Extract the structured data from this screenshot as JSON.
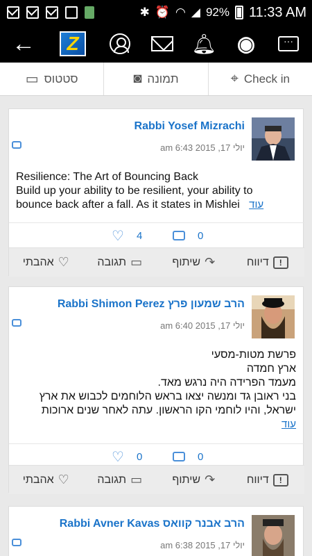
{
  "status_bar": {
    "battery": "92%",
    "time": "11:33 AM"
  },
  "app_bar": {
    "logo_letter": "Z"
  },
  "composer": {
    "tabs": [
      {
        "label": "סטטוס",
        "icon": "speech-bubble-icon"
      },
      {
        "label": "תמונה",
        "icon": "camera-icon"
      },
      {
        "label": "Check in",
        "icon": "location-pin-icon"
      }
    ]
  },
  "posts": [
    {
      "author": "Rabbi Yosef Mizrachi",
      "date": "יולי 17, 2015 6:43 am",
      "text_lines": [
        "Resilience: The Art of Bouncing Back",
        "Build up your ability to be resilient, your ability to",
        "bounce back after a fall. As it states in Mishlei"
      ],
      "more": "עוד",
      "likes": "4",
      "comments": "0"
    },
    {
      "author": "Rabbi Shimon Perez הרב שמעון פרץ",
      "date": "יולי 17, 2015 6:40 am",
      "text_lines": [
        "פרשת מטות-מסעי",
        "ארץ חמדה",
        "מעמד הפרידה היה נרגש מאד.",
        "בני ראובן גד ומנשה יצאו בראש הלוחמים לכבוש את ארץ",
        "ישראל, והיו לוחמי הקו הראשון. עתה לאחר שנים ארוכות"
      ],
      "more": "עוד",
      "likes": "0",
      "comments": "0"
    },
    {
      "author": "Rabbi Avner Kavas הרב אבנר קוואס",
      "date": "יולי 17, 2015 6:38 am"
    }
  ],
  "actions": {
    "report": "דיווח",
    "share": "שיתוף",
    "reply": "תגובה",
    "like": "אהבתי"
  }
}
